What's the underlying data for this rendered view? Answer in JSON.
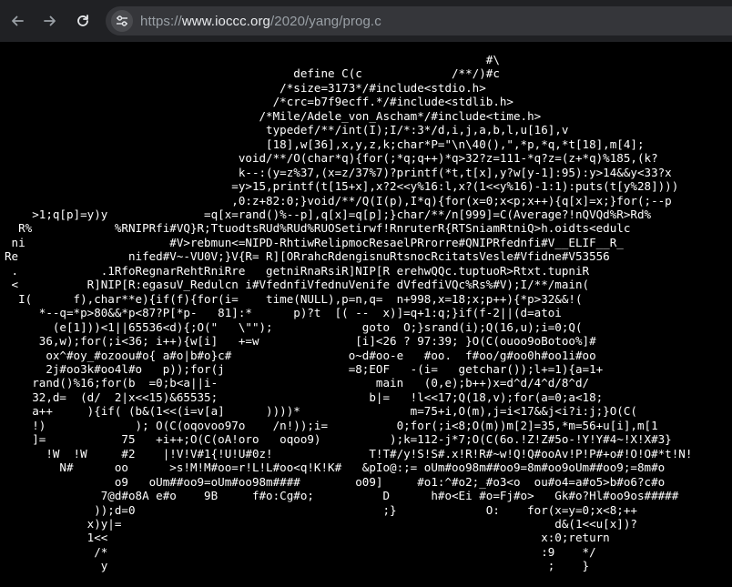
{
  "browser": {
    "back_icon": "arrow-left-icon",
    "forward_icon": "arrow-right-icon",
    "reload_icon": "reload-icon",
    "site_info_icon": "tune-icon",
    "url": {
      "scheme": "https://",
      "host": "www.ioccc.org",
      "path": "/2020/yang/prog.c"
    }
  },
  "page": {
    "source": "                                                                      #\\\n                                          define C(c             /**/)#c\n                                        /*size=3173*/#include<stdio.h>\n                                       /*crc=b7f9ecff.*/#include<stdlib.h>\n                                     /*Mile/Adele_von_Ascham*/#include<time.h>\n                                      typedef/**/int(I);I/*:3*/d,i,j,a,b,l,u[16],v\n                                      [18],w[36],x,y,z,k;char*P=\"\\n\\40(),\",*p,*q,*t[18],m[4];\n                                  void/**/O(char*q){for(;*q;q++)*q>32?z=111-*q?z=(z+*q)%185,(k?\n                                  k--:(y=z%37,(x=z/37%7)?printf(*t,t[x],y?w[y-1]:95):y>14&&y<33?x\n                                 =y>15,printf(t[15+x],x?2<<y%16:l,x?(1<<y%16)-1:1):puts(t[y%28])))\n                                 ,0:z+82:0;}void/**/Q(I(p),I*q){for(x=0;x<p;x++){q[x]=x;}for(;--p\n    >1;q[p]=y)y              =q[x=rand()%--p],q[x]=q[p];}char/**/n[999]=C(Average?!nQVQd%R>Rd%\n  R%            %RNIPRfi#VQ}R;TtuodtsRUd%RUd%RUOSetirwf!RnruterR{RTSniamRtniQ>h.oidts<edulc\n ni                     #V>rebmun<=NIPD-RhtiwRelipmocResaelPRrorre#QNIPRfednfi#V__ELIF__R_\nRe                nifed#V~-VU0V;}V{R= R][ORrahcRdengisnuRtsnocRcitatsVesle#Vfidne#V53556\n .            .1RfoRegnarRehtRniRre   getniRnaRsiR]NIP[R erehwQQc.tuptuoR>Rtxt.tupniR\n <          R]NIP[R:egasuV_Redulcn i#VfednfiVfednuVenife dVfedfiVQc%Rs%#V);I/**/main(\n  I(      f),char**e){if(f){for(i=    time(NULL),p=n,q=  n+998,x=18;x;p++){*p>32&&!(\n     *--q=*p>80&&*p<87?P[*p-   81]:*      p)?t  [( --  x)]=q+1:q;}if(f-2||(d=atoi\n       (e[1]))<1||65536<d){;O(\"   \\\"\");             goto  O;}srand(i);Q(16,u);i=0;Q(\n     36,w);for(;i<36; i++){w[i]   +=w              [i]<26 ? 97:39; }O(C(ouoo9oBotoo%]#\n      ox^#oy_#ozoou#o{ a#o|b#o}c#                 o~d#oo-e   #oo.  f#oo/g#oo0h#oo1i#oo\n      2j#oo3k#oo4l#o   p));for(j                  =8;EOF   -(i=   getchar());l+=1){a=1+\n    rand()%16;for(b  =0;b<a||i-                       main   (0,e);b++)x=d^d/4^d/8^d/\n    32,d=  (d/  2|x<<15)&65535;                      b|=   !l<<17;Q(18,v);for(a=0;a<18;\n    a++     ){if( (b&(1<<(i=v[a]      ))))*                m=75+i,O(m),j=i<17&&j<i?i:j;}O(C(\n    !)             ); O(C(oqovoo97o    /n!));i=          0;for(;i<8;O(m))m[2]=35,*m=56+u[i],m[1\n    ]=           75   +i++;O(C(oA!oro   oqoo9)          );k=112-j*7;O(C(6o.!Z!Z#5o-!Y!Y#4~!X!X#3}\n      !W  !W     #2    |!V!V#1{!U!U#0z!              T!T#/y!S!S#.x!R!R#~w!Q!Q#ooAv!P!P#+o#!O!O#*t!N!\n        N#      oo      >s!M!M#oo=r!L!L#oo<q!K!K#   &pIo@:;= oUm#oo98m##oo9=8m#oo9oUm##oo9;=8m#o\n                o9   oUm##oo9=oUm#oo98m####        o09]     #o1:^#o2;_#o3<o  ou#o4=a#o5>b#o6?c#o\n              7@d#o8A e#o    9B     f#o:Cg#o;          D      h#o<Ei #o=Fj#o>   Gk#o?Hl#oo9os#####\n             ));d=0                                    ;}             O:    for(x=y=0;x<8;++\n            x)y|=                                                               d&(1<<u[x])?\n            1<<                                                               x:0;return\n             /*                                                               :9    */\n              y                                                                ;    }"
  }
}
